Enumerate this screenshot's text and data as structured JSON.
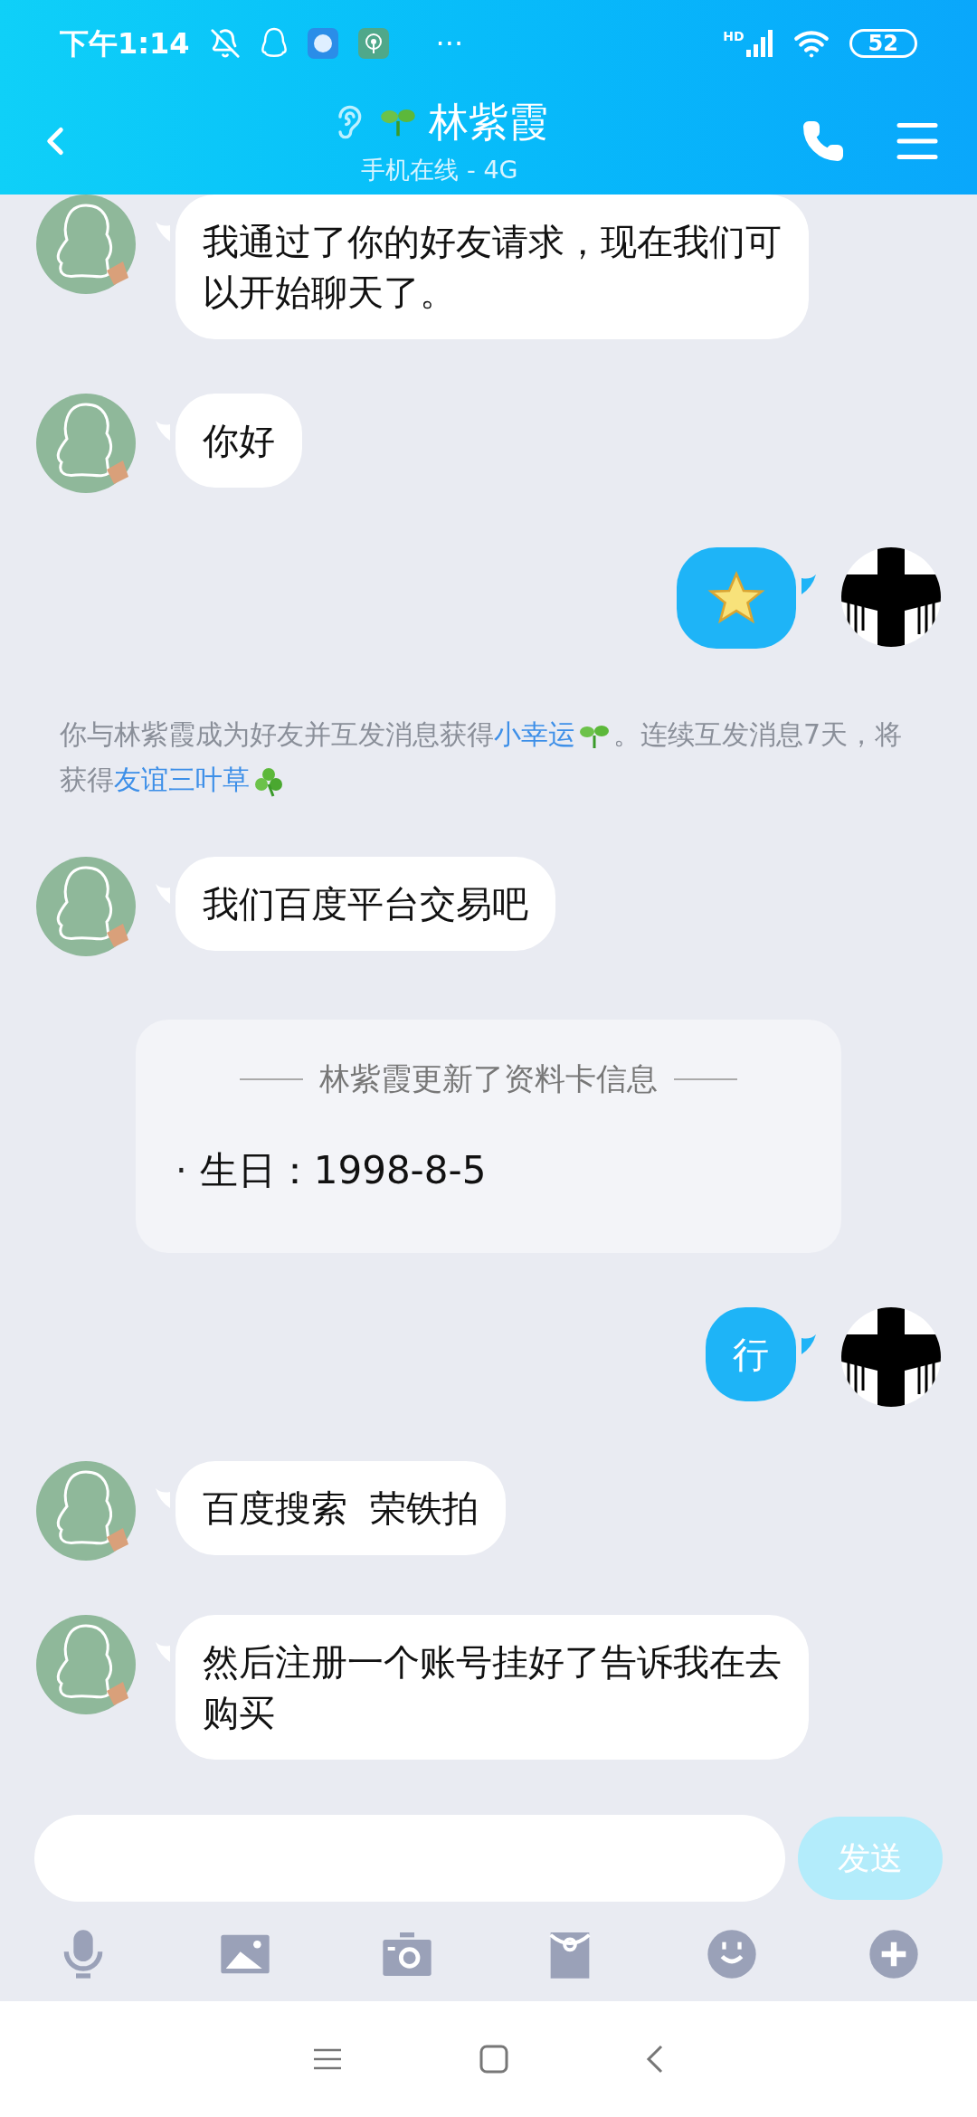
{
  "status_bar": {
    "time": "下午1:14",
    "more": "···",
    "signal_label": "HD",
    "battery": "52"
  },
  "header": {
    "title": "林紫霞",
    "subtitle": "手机在线 - 4G"
  },
  "messages": [
    {
      "kind": "text",
      "outgoing": false,
      "text": "我通过了你的好友请求，现在我们可以开始聊天了。"
    },
    {
      "kind": "text",
      "outgoing": false,
      "text": "你好"
    },
    {
      "kind": "sticker",
      "outgoing": true
    },
    {
      "kind": "system",
      "segments": [
        {
          "kind": "text",
          "text": "你与林紫霞成为好友并互发消息获得"
        },
        {
          "kind": "link",
          "text": "小幸运"
        },
        {
          "kind": "icon"
        },
        {
          "kind": "text",
          "text": "。连续互发消息7天，将获得"
        },
        {
          "kind": "link",
          "text": "友谊三叶草"
        },
        {
          "kind": "icon"
        }
      ]
    },
    {
      "kind": "text",
      "outgoing": false,
      "text": "我们百度平台交易吧"
    },
    {
      "kind": "profile_card",
      "title": "林紫霞更新了资料卡信息",
      "bullet": "·",
      "item": "生日：1998-8-5"
    },
    {
      "kind": "text",
      "outgoing": true,
      "text": "行"
    },
    {
      "kind": "text",
      "outgoing": false,
      "text": "百度搜索  荣铁拍"
    },
    {
      "kind": "text",
      "outgoing": false,
      "text": "然后注册一个账号挂好了告诉我在去购买"
    }
  ],
  "composer": {
    "send": "发送",
    "send_disabled": true
  }
}
